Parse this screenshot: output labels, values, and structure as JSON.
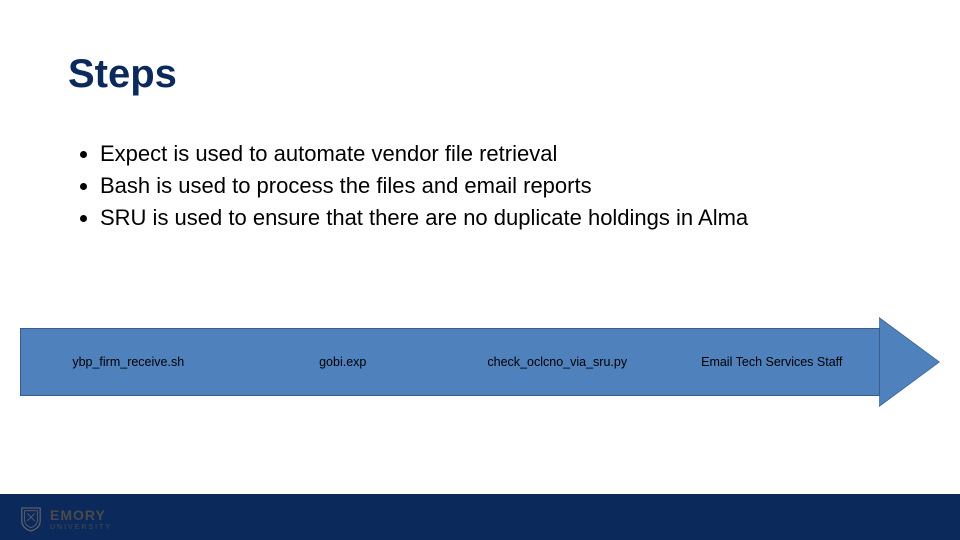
{
  "title": "Steps",
  "bullets": [
    "Expect is used to automate vendor file retrieval",
    "Bash is used to process the files and email reports",
    "SRU is used to ensure that there are no duplicate holdings in Alma"
  ],
  "arrow": {
    "steps": [
      "ybp_firm_receive.sh",
      "gobi.exp",
      "check_oclcno_via_sru.py",
      "Email Tech Services Staff"
    ]
  },
  "footer": {
    "org_main": "EMORY",
    "org_sub": "UNIVERSITY"
  }
}
